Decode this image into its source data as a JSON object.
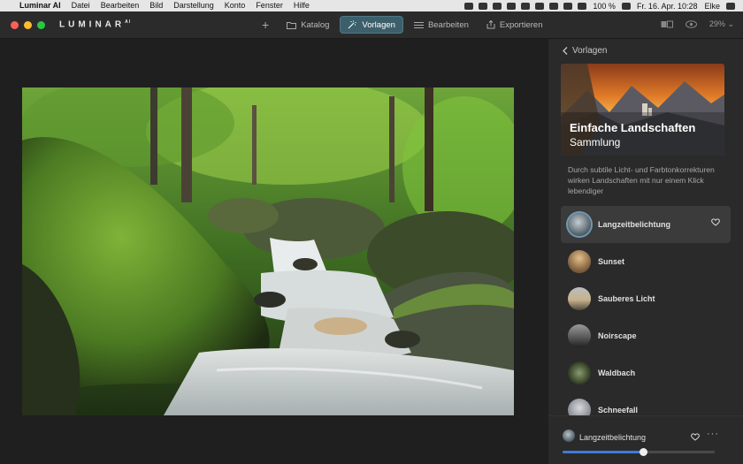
{
  "menubar": {
    "app_name": "Luminar AI",
    "items": [
      "Datei",
      "Bearbeiten",
      "Bild",
      "Darstellung",
      "Konto",
      "Fenster",
      "Hilfe"
    ],
    "battery": "100 %",
    "datetime": "Fr. 16. Apr.  10:28",
    "user": "Elke"
  },
  "toolbar": {
    "logo": "LUMINAR",
    "logo_sup": "AI",
    "tabs": [
      {
        "label": "Katalog",
        "icon": "folder-icon"
      },
      {
        "label": "Vorlagen",
        "icon": "templates-icon"
      },
      {
        "label": "Bearbeiten",
        "icon": "sliders-icon"
      },
      {
        "label": "Exportieren",
        "icon": "export-icon"
      }
    ],
    "active_tab": "Vorlagen",
    "zoom": "29%"
  },
  "panel": {
    "back_label": "Vorlagen",
    "collection_title": "Einfache Landschaften",
    "collection_subtitle": "Sammlung",
    "description": "Durch subtile Licht- und Farbtonkorrekturen wirken Landschaften mit nur einem Klick lebendiger",
    "presets": [
      {
        "label": "Langzeitbelichtung",
        "selected": true
      },
      {
        "label": "Sunset",
        "selected": false
      },
      {
        "label": "Sauberes Licht",
        "selected": false
      },
      {
        "label": "Noirscape",
        "selected": false
      },
      {
        "label": "Waldbach",
        "selected": false
      },
      {
        "label": "Schneefall",
        "selected": false
      }
    ],
    "current_preset": "Langzeitbelichtung",
    "more_label": "···",
    "amount_fraction": 0.53
  },
  "colors": {
    "accent": "#3f7bd8",
    "active_tab": "#3d5f6b",
    "panel_bg": "#2a2a2a",
    "canvas_bg": "#1f1f1f"
  }
}
